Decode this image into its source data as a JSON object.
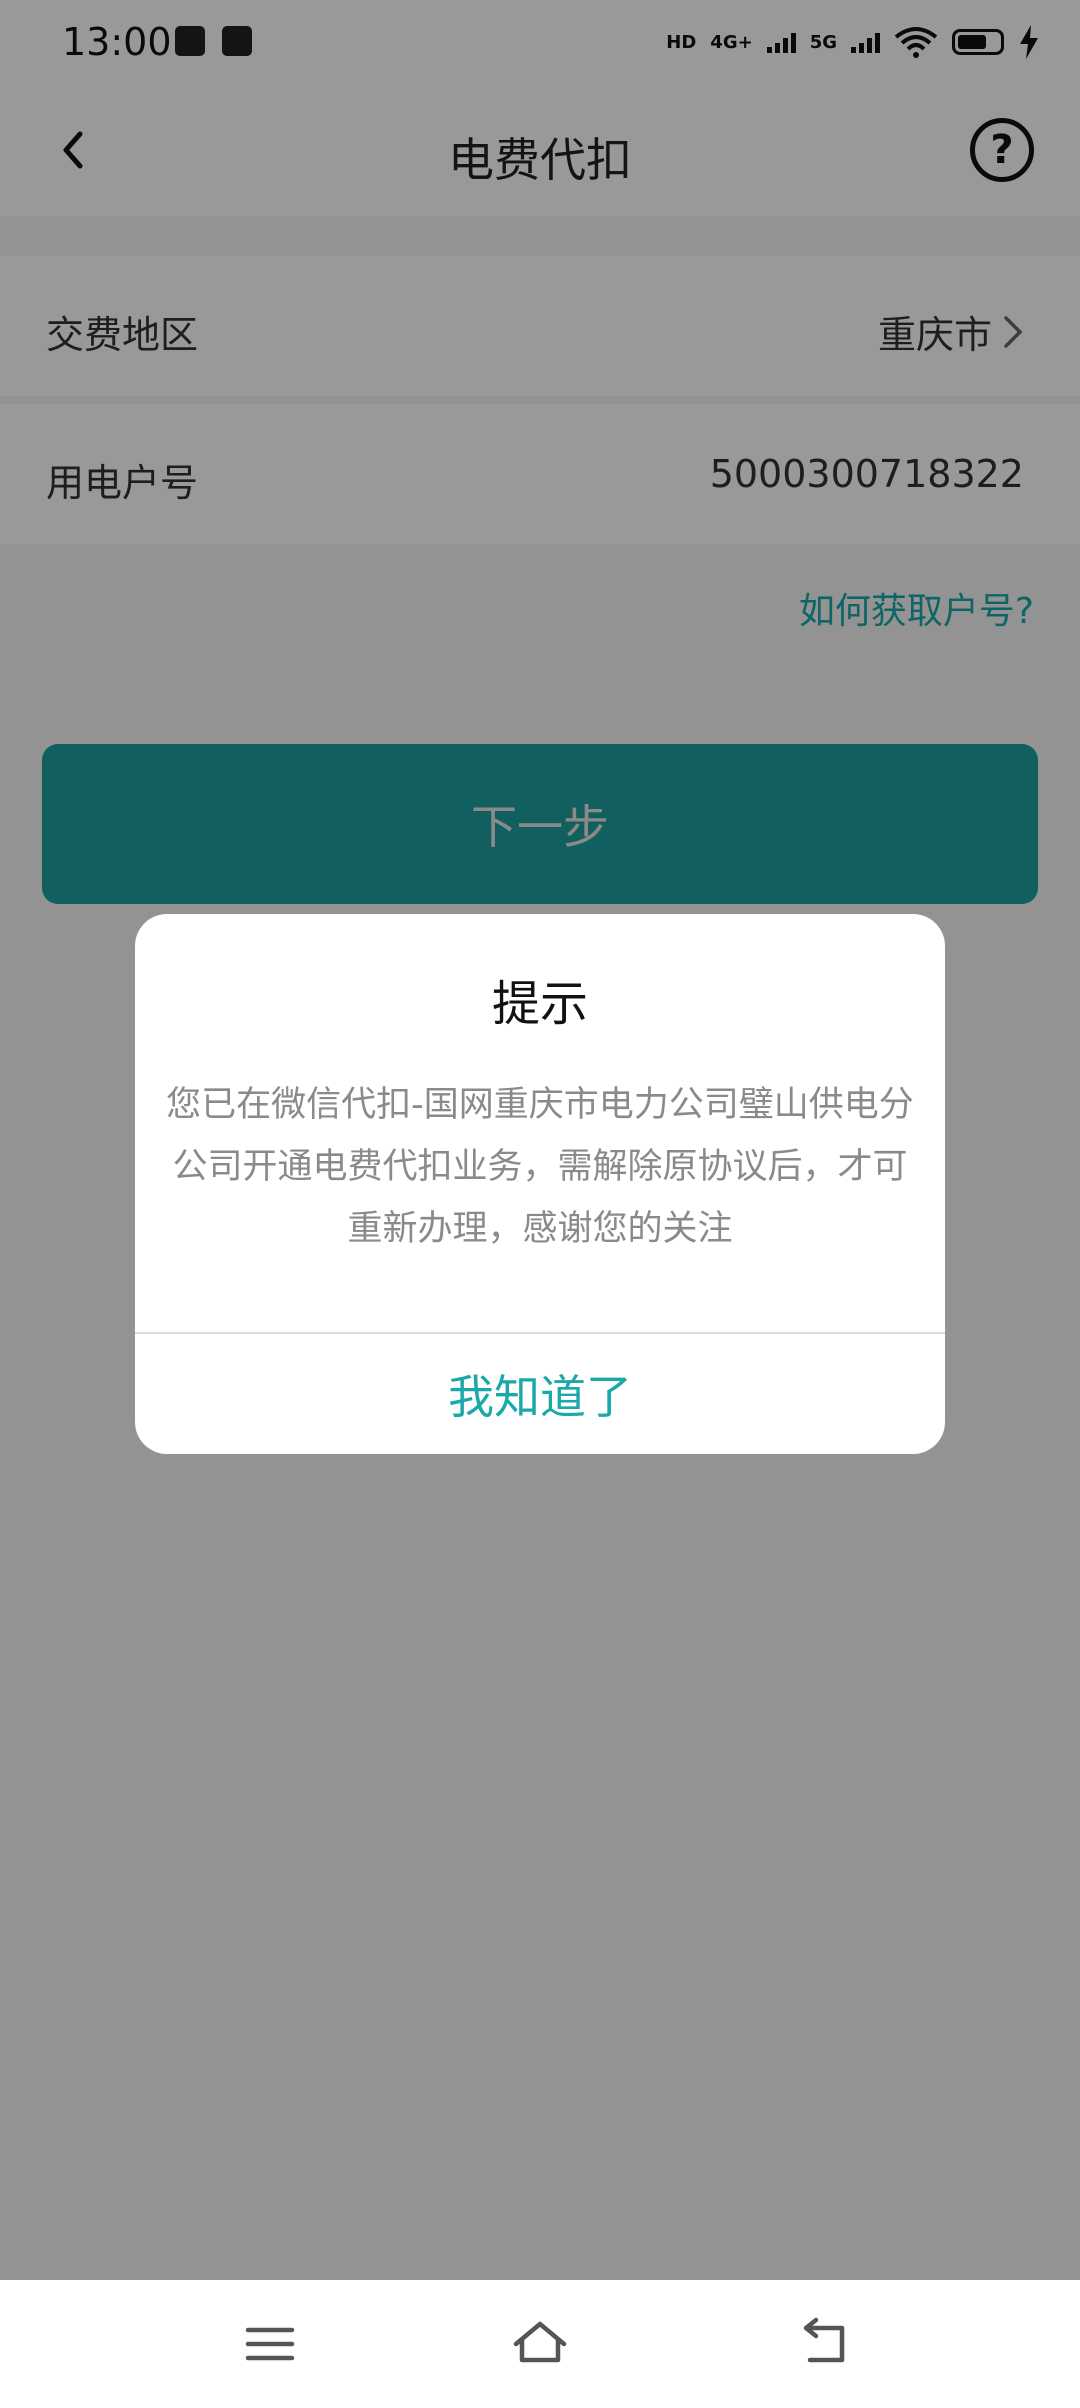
{
  "status_bar": {
    "time": "13:00",
    "signal_labels": [
      "HD",
      "4G+",
      "5G"
    ],
    "icons": [
      "app-notification-icon",
      "message-icon",
      "wifi-icon",
      "battery-icon",
      "charging-icon"
    ]
  },
  "header": {
    "title": "电费代扣",
    "help_label": "?"
  },
  "form": {
    "region_label": "交费地区",
    "region_value": "重庆市",
    "account_label": "用电户号",
    "account_value": "5000300718322",
    "help_link": "如何获取户号?"
  },
  "next_button": "下一步",
  "dialog": {
    "title": "提示",
    "message": "您已在微信代扣-国网重庆市电力公司璧山供电分公司开通电费代扣业务，需解除原协议后，才可重新办理，感谢您的关注",
    "confirm": "我知道了"
  },
  "colors": {
    "accent": "#1aa8a8",
    "button": "#1f9e9e",
    "overlay": "rgba(0,0,0,0.40)"
  }
}
